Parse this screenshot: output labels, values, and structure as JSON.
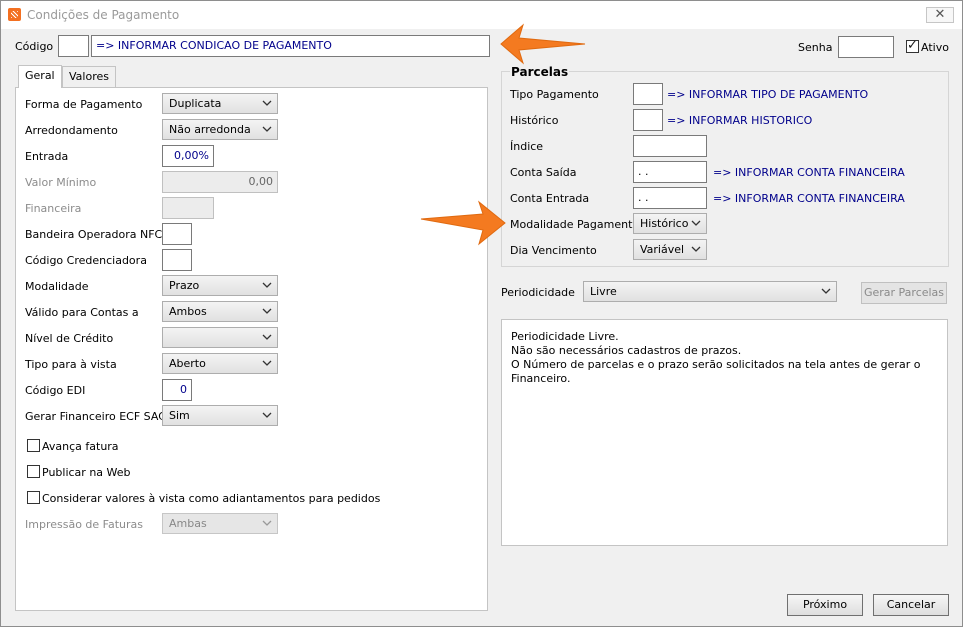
{
  "window": {
    "title": "Condições de Pagamento"
  },
  "header": {
    "codigo_label": "Código",
    "codigo_value": "",
    "descricao_value": "=> INFORMAR CONDICAO DE PAGAMENTO",
    "senha_label": "Senha",
    "senha_value": "",
    "ativo_label": "Ativo",
    "ativo_checked": true
  },
  "tabs": [
    {
      "label": "Geral",
      "active": true
    },
    {
      "label": "Valores",
      "active": false
    }
  ],
  "geral": {
    "forma_pagamento": {
      "label": "Forma de Pagamento",
      "value": "Duplicata"
    },
    "arredondamento": {
      "label": "Arredondamento",
      "value": "Não arredonda"
    },
    "entrada": {
      "label": "Entrada",
      "value": "0,00%"
    },
    "valor_minimo": {
      "label": "Valor Mínimo",
      "value": "0,00"
    },
    "financeira": {
      "label": "Financeira",
      "value": ""
    },
    "bandeira": {
      "label": "Bandeira Operadora NFC-e",
      "value": ""
    },
    "credenciadora": {
      "label": "Código Credenciadora",
      "value": ""
    },
    "modalidade": {
      "label": "Modalidade",
      "value": "Prazo"
    },
    "valido_contas": {
      "label": "Válido para Contas a",
      "value": "Ambos"
    },
    "nivel_credito": {
      "label": "Nível de Crédito",
      "value": ""
    },
    "tipo_vista": {
      "label": "Tipo para à vista",
      "value": "Aberto"
    },
    "codigo_edi": {
      "label": "Código EDI",
      "value": "0"
    },
    "gerar_financeiro": {
      "label": "Gerar Financeiro ECF SAC",
      "value": "Sim"
    },
    "avanca_fatura": {
      "label": "Avança fatura",
      "checked": false
    },
    "publicar_web": {
      "label": "Publicar na Web",
      "checked": false
    },
    "considerar_valores": {
      "label": "Considerar valores à vista como adiantamentos para pedidos",
      "checked": false
    },
    "impressao_faturas": {
      "label": "Impressão de Faturas",
      "value": "Ambas"
    }
  },
  "parcelas": {
    "title": "Parcelas",
    "tipo_pagamento": {
      "label": "Tipo Pagamento",
      "value": "",
      "info": "=> INFORMAR TIPO DE PAGAMENTO"
    },
    "historico": {
      "label": "Histórico",
      "value": "",
      "info": "=> INFORMAR HISTORICO"
    },
    "indice": {
      "label": "Índice",
      "value": ""
    },
    "conta_saida": {
      "label": "Conta Saída",
      "value": " . .",
      "info": "=> INFORMAR CONTA FINANCEIRA"
    },
    "conta_entrada": {
      "label": "Conta Entrada",
      "value": " . .",
      "info": "=> INFORMAR CONTA FINANCEIRA"
    },
    "modalidade_pagamento": {
      "label": "Modalidade Pagamento",
      "value": "Histórico"
    },
    "dia_vencimento": {
      "label": "Dia Vencimento",
      "value": "Variável"
    }
  },
  "periodicidade": {
    "label": "Periodicidade",
    "value": "Livre",
    "gerar_parcelas_label": "Gerar Parcelas",
    "memo_lines": [
      "Periodicidade Livre.",
      "Não são necessários cadastros de prazos.",
      "O Número de parcelas e o prazo serão solicitados na tela antes de gerar o",
      "Financeiro."
    ]
  },
  "footer": {
    "proximo_label": "Próximo",
    "cancelar_label": "Cancelar"
  },
  "colors": {
    "info_text": "#00008b",
    "arrow": "#f47a20"
  }
}
